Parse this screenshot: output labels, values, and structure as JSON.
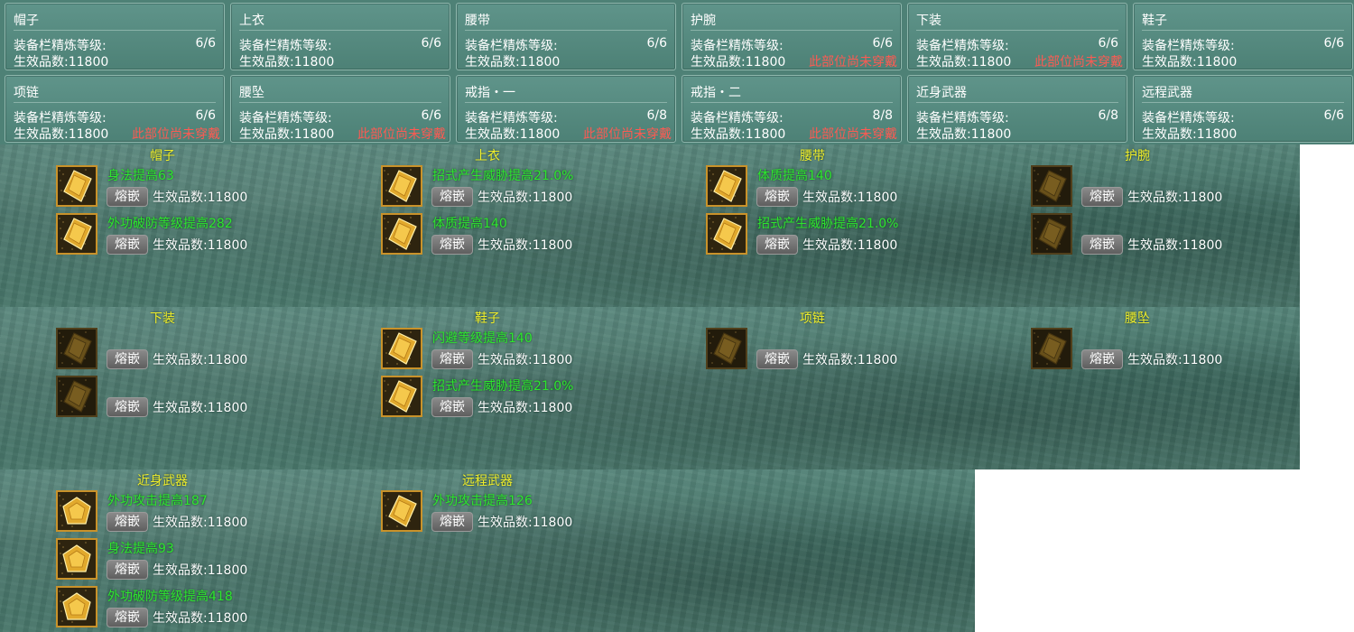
{
  "summary": {
    "refine_label": "装备栏精炼等级:",
    "count_label": "生效品数:",
    "warning_text": "此部位尚未穿戴",
    "slots": [
      {
        "title": "帽子",
        "refine": "6/6",
        "count": "11800",
        "warning": false
      },
      {
        "title": "上衣",
        "refine": "6/6",
        "count": "11800",
        "warning": false
      },
      {
        "title": "腰带",
        "refine": "6/6",
        "count": "11800",
        "warning": false
      },
      {
        "title": "护腕",
        "refine": "6/6",
        "count": "11800",
        "warning": true
      },
      {
        "title": "下装",
        "refine": "6/6",
        "count": "11800",
        "warning": true
      },
      {
        "title": "鞋子",
        "refine": "6/6",
        "count": "11800",
        "warning": false
      },
      {
        "title": "项链",
        "refine": "6/6",
        "count": "11800",
        "warning": true
      },
      {
        "title": "腰坠",
        "refine": "6/6",
        "count": "11800",
        "warning": true
      },
      {
        "title": "戒指・一",
        "refine": "6/8",
        "count": "11800",
        "warning": true
      },
      {
        "title": "戒指・二",
        "refine": "8/8",
        "count": "11800",
        "warning": true
      },
      {
        "title": "近身武器",
        "refine": "6/8",
        "count": "11800",
        "warning": false
      },
      {
        "title": "远程武器",
        "refine": "6/6",
        "count": "11800",
        "warning": false
      }
    ]
  },
  "details": {
    "inlay_label": "熔嵌",
    "count_label": "生效品数:",
    "panels": [
      {
        "title": "帽子",
        "gems": [
          {
            "effect": "身法提高63",
            "count": "11800",
            "empty": false,
            "shape": "diamond"
          },
          {
            "effect": "外功破防等级提高282",
            "count": "11800",
            "empty": false,
            "shape": "diamond"
          }
        ]
      },
      {
        "title": "上衣",
        "gems": [
          {
            "effect": "招式产生威胁提高21.0%",
            "count": "11800",
            "empty": false,
            "shape": "diamond"
          },
          {
            "effect": "体质提高140",
            "count": "11800",
            "empty": false,
            "shape": "diamond"
          }
        ]
      },
      {
        "title": "腰带",
        "gems": [
          {
            "effect": "体质提高140",
            "count": "11800",
            "empty": false,
            "shape": "diamond"
          },
          {
            "effect": "招式产生威胁提高21.0%",
            "count": "11800",
            "empty": false,
            "shape": "diamond"
          }
        ]
      },
      {
        "title": "护腕",
        "gems": [
          {
            "effect": "",
            "count": "11800",
            "empty": true,
            "shape": "diamond"
          },
          {
            "effect": "",
            "count": "11800",
            "empty": true,
            "shape": "diamond"
          }
        ]
      },
      {
        "title": "下装",
        "gems": [
          {
            "effect": "",
            "count": "11800",
            "empty": true,
            "shape": "diamond"
          },
          {
            "effect": "",
            "count": "11800",
            "empty": true,
            "shape": "diamond"
          }
        ]
      },
      {
        "title": "鞋子",
        "gems": [
          {
            "effect": "闪避等级提高140",
            "count": "11800",
            "empty": false,
            "shape": "diamond"
          },
          {
            "effect": "招式产生威胁提高21.0%",
            "count": "11800",
            "empty": false,
            "shape": "diamond"
          }
        ]
      },
      {
        "title": "项链",
        "gems": [
          {
            "effect": "",
            "count": "11800",
            "empty": true,
            "shape": "diamond"
          }
        ]
      },
      {
        "title": "腰坠",
        "gems": [
          {
            "effect": "",
            "count": "11800",
            "empty": true,
            "shape": "diamond"
          }
        ]
      },
      {
        "title": "近身武器",
        "gems": [
          {
            "effect": "外功攻击提高187",
            "count": "11800",
            "empty": false,
            "shape": "pentagon"
          },
          {
            "effect": "身法提高93",
            "count": "11800",
            "empty": false,
            "shape": "pentagon"
          },
          {
            "effect": "外功破防等级提高418",
            "count": "11800",
            "empty": false,
            "shape": "pentagon"
          }
        ]
      },
      {
        "title": "远程武器",
        "gems": [
          {
            "effect": "外功攻击提高126",
            "count": "11800",
            "empty": false,
            "shape": "diamond"
          }
        ]
      }
    ]
  },
  "colors": {
    "panel_title": "#f2ef2a",
    "gem_effect": "#2ee62e",
    "warning": "#ff5a52",
    "gem_border": "#c9922a"
  }
}
